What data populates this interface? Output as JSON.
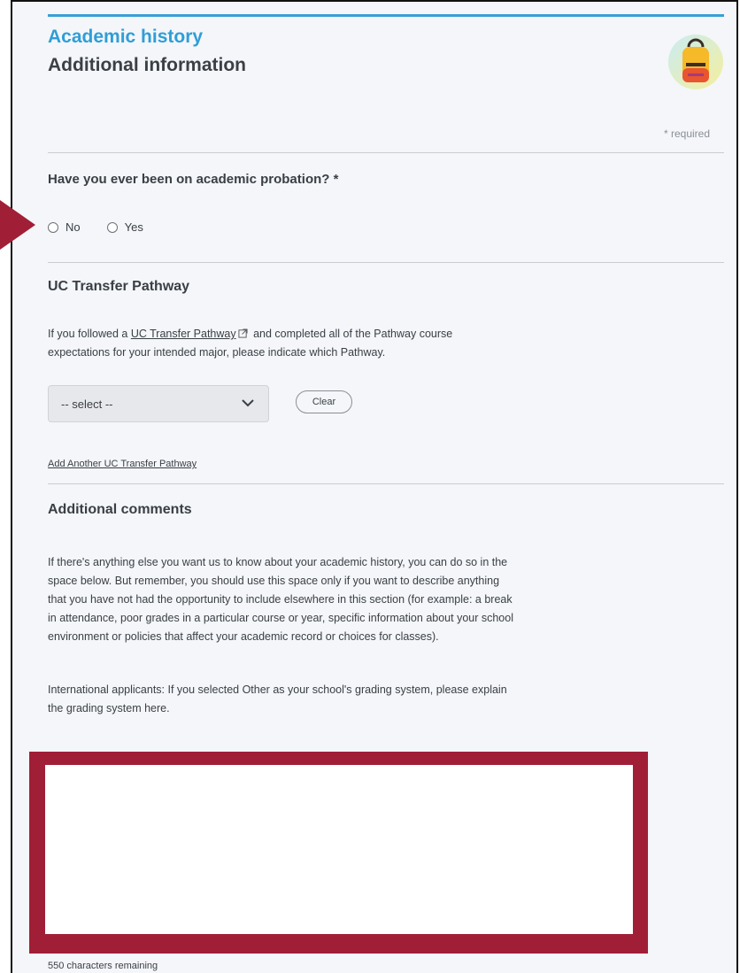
{
  "header": {
    "eyebrow": "Academic history",
    "title": "Additional information",
    "required_note": "* required",
    "icon": "backpack-icon"
  },
  "probation": {
    "question": "Have you ever been on academic probation? *",
    "options": [
      {
        "label": "No",
        "selected": false
      },
      {
        "label": "Yes",
        "selected": false
      }
    ]
  },
  "pathway": {
    "title": "UC Transfer Pathway",
    "text_before_link": "If you followed a ",
    "link_text": "UC Transfer Pathway",
    "text_after_link": " and completed all of the Pathway course",
    "text_line2": "expectations for your intended major, please indicate which Pathway.",
    "select_value": "-- select --",
    "clear_label": "Clear",
    "add_another": "Add Another UC Transfer Pathway"
  },
  "comments": {
    "title": "Additional comments",
    "paragraph1": [
      "If there's anything else you want us to know about your academic history, you can do so in the",
      "space below. But remember, you should use this space only if you want to describe anything",
      "that you have not had the opportunity to include elsewhere in this section (for example: a break",
      "in attendance, poor grades in a particular course or year, specific information about your school",
      "environment or policies that affect your academic record or choices for classes)."
    ],
    "paragraph2": [
      "International applicants: If you selected Other as your school's grading system, please explain",
      "the grading system here."
    ],
    "textarea_value": "",
    "remaining": "550 characters remaining"
  },
  "colors": {
    "accent": "#2f9ed8",
    "highlight": "#a01f37",
    "background": "#f4f6f9"
  }
}
